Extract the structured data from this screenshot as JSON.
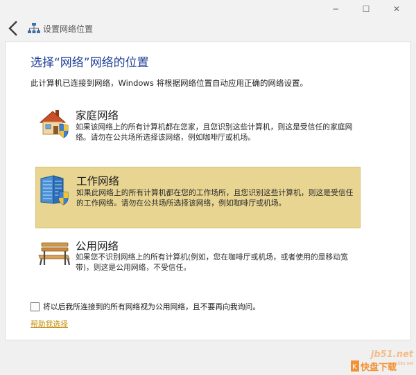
{
  "window": {
    "title": "设置网络位置"
  },
  "controls": {
    "minimize": "−",
    "maximize": "☐",
    "close": "✕"
  },
  "icons": {
    "back": "chevron-left-icon",
    "title": "network-icon",
    "home": "house-shield-icon",
    "work": "office-building-shield-icon",
    "public": "park-bench-icon"
  },
  "colors": {
    "heading": "#1e3f96",
    "selected_background": "#e8d591",
    "link": "#c38f0a"
  },
  "dialog": {
    "heading": "选择“网络”网络的位置",
    "description": "此计算机已连接到网络，Windows 将根据网络位置自动应用正确的网络设置。"
  },
  "options": [
    {
      "title": "家庭网络",
      "description": "如果该网络上的所有计算机都在您家，且您识别这些计算机，则这是受信任的家庭网络。请勿在公共场所选择该网络，例如咖啡厅或机场。",
      "selected": false
    },
    {
      "title": "工作网络",
      "description": "如果此网络上的所有计算机都在您的工作场所，且您识别这些计算机，则这是受信任的工作网络。请勿在公共场所选择该网络，例如咖啡厅或机场。",
      "selected": true
    },
    {
      "title": "公用网络",
      "description": "如果您不识别网络上的所有计算机(例如，您在咖啡厅或机场，或者使用的是移动宽带)，则这是公用网络，不受信任。",
      "selected": false
    }
  ],
  "checkbox": {
    "label": "将以后我所连接到的所有网络视为公用网络，且不要再向我询问。",
    "checked": false
  },
  "help": {
    "link": "帮助我选择"
  },
  "watermark": {
    "url": "jb51.net",
    "brand": "快盘下载",
    "site": "www.kkx.net"
  }
}
